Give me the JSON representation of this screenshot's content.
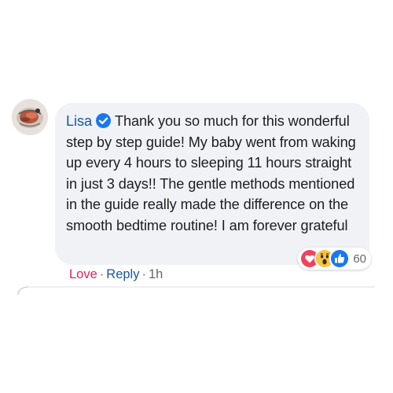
{
  "comment": {
    "author": "Lisa",
    "text": "Thank you so much for this wonderful step by step guide! My baby went from waking up every 4 hours to sleeping 11 hours straight in just 3 days!! The gentle methods mentioned in the guide really made the difference on the smooth bedtime routine! I am forever grateful",
    "verified_badge_color": "#1877f2"
  },
  "reactions": {
    "icons": [
      "love-icon",
      "wow-icon",
      "like-icon"
    ],
    "count": "60"
  },
  "actions": {
    "love_label": "Love",
    "reply_label": "Reply",
    "separator": "·",
    "time_label": "1h"
  },
  "colors": {
    "author_blue": "#1b56a6",
    "love_red": "#e0245e",
    "bubble_bg": "#f0f2f5",
    "meta_gray": "#65676b"
  }
}
